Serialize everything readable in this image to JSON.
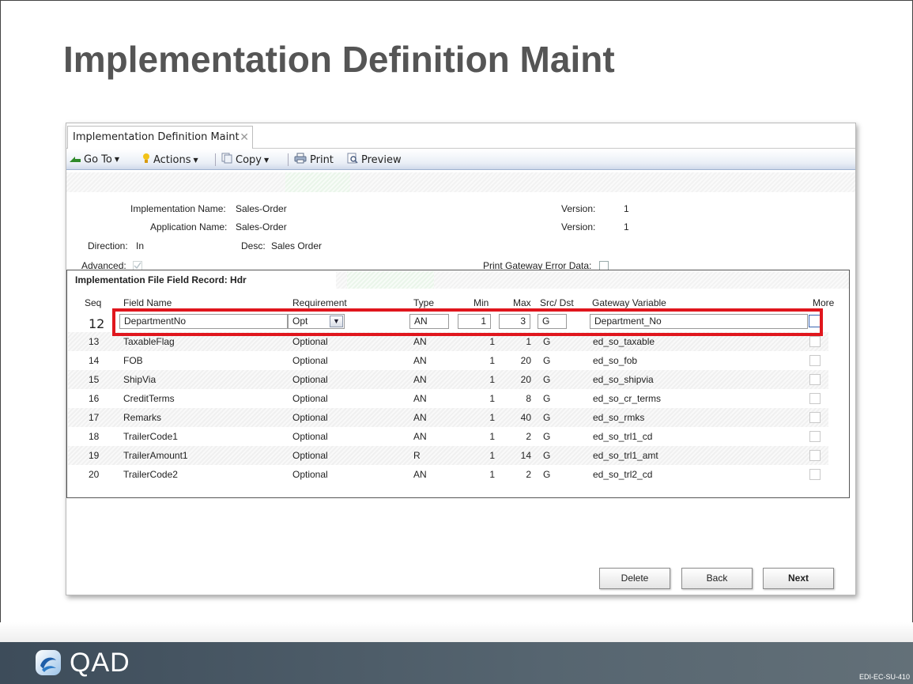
{
  "slide": {
    "title": "Implementation Definition Maint"
  },
  "tab": {
    "label": "Implementation Definition Maint",
    "close": "✕"
  },
  "toolbar": {
    "goto": "Go To",
    "actions": "Actions",
    "copy": "Copy",
    "print": "Print",
    "preview": "Preview"
  },
  "header": {
    "impl_name_label": "Implementation Name:",
    "impl_name_value": "Sales-Order",
    "app_name_label": "Application Name:",
    "app_name_value": "Sales-Order",
    "version_label_1": "Version:",
    "version_value_1": "1",
    "version_label_2": "Version:",
    "version_value_2": "1",
    "direction_label": "Direction:",
    "direction_value": "In",
    "desc_label": "Desc:",
    "desc_value": "Sales Order",
    "advanced_label": "Advanced:",
    "print_gateway_label": "Print Gateway Error Data:"
  },
  "panel": {
    "title": "Implementation File Field Record: Hdr",
    "columns": {
      "seq": "Seq",
      "field_name": "Field Name",
      "requirement": "Requirement",
      "type": "Type",
      "min": "Min",
      "max": "Max",
      "src_dst": "Src/ Dst",
      "gateway_variable": "Gateway Variable",
      "more": "More"
    },
    "edit_row": {
      "seq": "12",
      "field_name": "DepartmentNo",
      "requirement": "Opt",
      "type": "AN",
      "min": "1",
      "max": "3",
      "src_dst": "G",
      "gateway_variable": "Department_No"
    },
    "rows": [
      {
        "seq": "13",
        "field_name": "TaxableFlag",
        "requirement": "Optional",
        "type": "AN",
        "min": "1",
        "max": "1",
        "src": "G",
        "var": "ed_so_taxable"
      },
      {
        "seq": "14",
        "field_name": "FOB",
        "requirement": "Optional",
        "type": "AN",
        "min": "1",
        "max": "20",
        "src": "G",
        "var": "ed_so_fob"
      },
      {
        "seq": "15",
        "field_name": "ShipVia",
        "requirement": "Optional",
        "type": "AN",
        "min": "1",
        "max": "20",
        "src": "G",
        "var": "ed_so_shipvia"
      },
      {
        "seq": "16",
        "field_name": "CreditTerms",
        "requirement": "Optional",
        "type": "AN",
        "min": "1",
        "max": "8",
        "src": "G",
        "var": "ed_so_cr_terms"
      },
      {
        "seq": "17",
        "field_name": "Remarks",
        "requirement": "Optional",
        "type": "AN",
        "min": "1",
        "max": "40",
        "src": "G",
        "var": "ed_so_rmks"
      },
      {
        "seq": "18",
        "field_name": "TrailerCode1",
        "requirement": "Optional",
        "type": "AN",
        "min": "1",
        "max": "2",
        "src": "G",
        "var": "ed_so_trl1_cd"
      },
      {
        "seq": "19",
        "field_name": "TrailerAmount1",
        "requirement": "Optional",
        "type": "R",
        "min": "1",
        "max": "14",
        "src": "G",
        "var": "ed_so_trl1_amt"
      },
      {
        "seq": "20",
        "field_name": "TrailerCode2",
        "requirement": "Optional",
        "type": "AN",
        "min": "1",
        "max": "2",
        "src": "G",
        "var": "ed_so_trl2_cd"
      }
    ]
  },
  "buttons": {
    "delete": "Delete",
    "back": "Back",
    "next": "Next"
  },
  "footer": {
    "logo": "QAD",
    "doc_code": "EDI-EC-SU-410"
  },
  "colors": {
    "highlight": "#e0161d",
    "footer": "#3d4c5a",
    "title": "#555555"
  }
}
